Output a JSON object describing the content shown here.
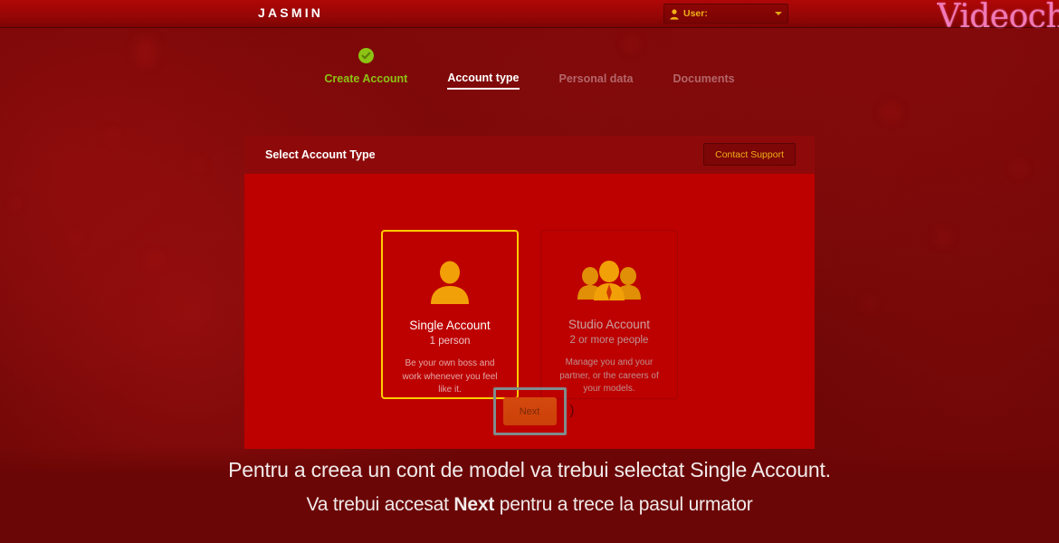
{
  "topbar": {
    "brand": "JASMIN",
    "user_label": "User:",
    "user_icon": "person-icon",
    "caret_icon": "chevron-down-icon",
    "watermark": "Videoch"
  },
  "steps": [
    {
      "label": "Create Account",
      "state": "done",
      "icon": "check-circle-icon"
    },
    {
      "label": "Account type",
      "state": "active"
    },
    {
      "label": "Personal data",
      "state": "pending"
    },
    {
      "label": "Documents",
      "state": "pending"
    }
  ],
  "panel": {
    "title": "Select Account Type",
    "contact_support_label": "Contact Support"
  },
  "cards": [
    {
      "id": "single",
      "icon": "single-person-icon",
      "title": "Single Account",
      "subtitle": "1 person",
      "description": "Be your own boss and work whenever you feel like it.",
      "selected": true
    },
    {
      "id": "studio",
      "icon": "group-people-icon",
      "title": "Studio Account",
      "subtitle": "2 or more people",
      "description": "Manage you and your partner, or the careers of your models.",
      "selected": false
    }
  ],
  "next_button": {
    "label": "Next",
    "trailing_glyph": ")"
  },
  "caption": {
    "line1": "Pentru a creea un cont de model va trebui selectat Single Account.",
    "line2_before": "Va trebui accesat ",
    "line2_bold": "Next",
    "line2_after": " pentru a trece la pasul urmator"
  },
  "colors": {
    "accent_yellow": "#ffcc00",
    "brand_red": "#bd0000",
    "panel_header_red": "#8e0a0a",
    "orange_icon": "#f2a007",
    "green_check": "#8cc314",
    "next_orange": "#cc4009",
    "highlight_gray": "#7f8c8d",
    "gold_text": "#f0b018",
    "pink_logo": "#f07ab8"
  }
}
